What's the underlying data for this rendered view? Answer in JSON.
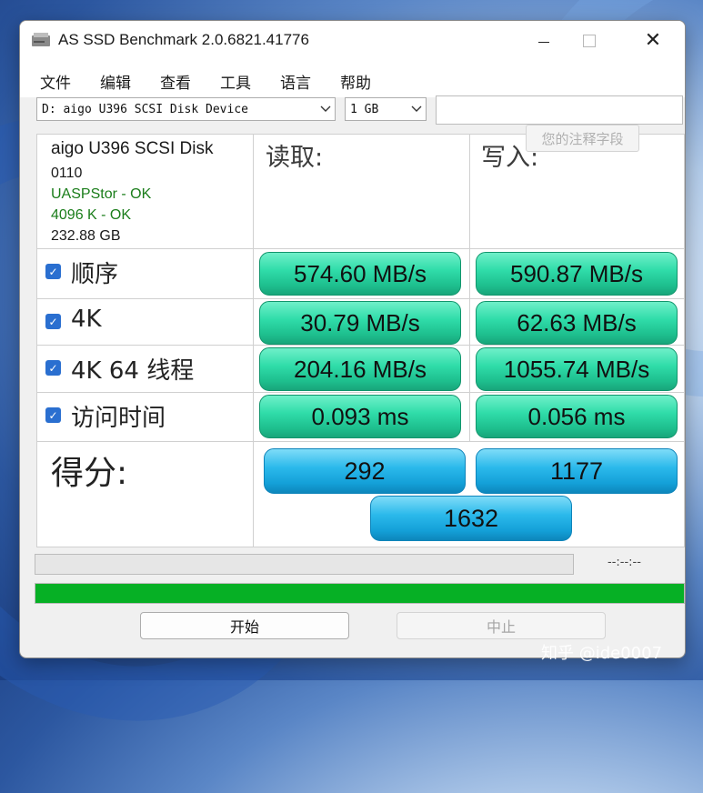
{
  "window": {
    "title": "AS SSD Benchmark 2.0.6821.41776"
  },
  "menu": [
    "文件",
    "编辑",
    "查看",
    "工具",
    "语言",
    "帮助"
  ],
  "toolbar": {
    "drive": "D: aigo U396 SCSI Disk Device",
    "size": "1 GB",
    "comment_placeholder": "您的注释字段"
  },
  "device": {
    "name": "aigo U396 SCSI Disk",
    "firmware": "0110",
    "driver_status": "UASPStor - OK",
    "alignment_status": "4096 K - OK",
    "capacity": "232.88 GB"
  },
  "columns": {
    "read": "读取:",
    "write": "写入:"
  },
  "tests": [
    {
      "label": "顺序",
      "checked": true,
      "read": "574.60 MB/s",
      "write": "590.87 MB/s"
    },
    {
      "label": "4K",
      "checked": true,
      "read": "30.79 MB/s",
      "write": "62.63 MB/s"
    },
    {
      "label": "4K 64 线程",
      "checked": true,
      "read": "204.16 MB/s",
      "write": "1055.74 MB/s"
    },
    {
      "label": "访问时间",
      "checked": true,
      "read": "0.093 ms",
      "write": "0.056 ms"
    }
  ],
  "score": {
    "label": "得分:",
    "read": "292",
    "write": "1177",
    "total": "1632"
  },
  "status": {
    "time": "--:--:--",
    "progress_fraction": 1.0
  },
  "buttons": {
    "start": "开始",
    "abort": "中止"
  },
  "watermark": "知乎 @ide0007",
  "colors": {
    "result": "#2fdca9",
    "score": "#2bb9eb",
    "progress": "#06b025",
    "ok_text": "#1a7d1a"
  }
}
